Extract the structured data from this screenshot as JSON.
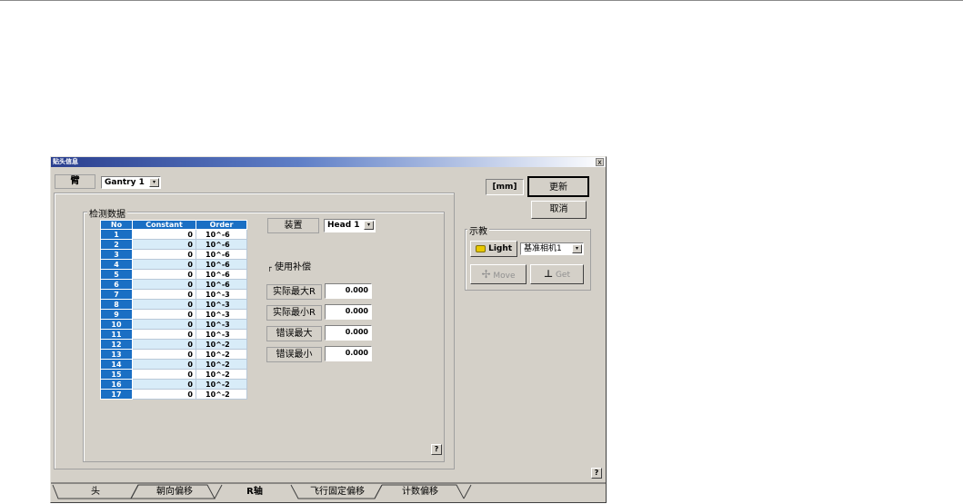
{
  "window": {
    "title": "贴头信息",
    "close": "x"
  },
  "arm": {
    "label": "臂",
    "value": "Gantry 1",
    "dropdown": "▾"
  },
  "unit": "[mm]",
  "buttons": {
    "update": "更新",
    "cancel": "取消"
  },
  "detection": {
    "caption": "检测数据",
    "columns": [
      "No",
      "Constant",
      "Order"
    ],
    "rows": [
      [
        "1",
        "0",
        "10^-6"
      ],
      [
        "2",
        "0",
        "10^-6"
      ],
      [
        "3",
        "0",
        "10^-6"
      ],
      [
        "4",
        "0",
        "10^-6"
      ],
      [
        "5",
        "0",
        "10^-6"
      ],
      [
        "6",
        "0",
        "10^-6"
      ],
      [
        "7",
        "0",
        "10^-3"
      ],
      [
        "8",
        "0",
        "10^-3"
      ],
      [
        "9",
        "0",
        "10^-3"
      ],
      [
        "10",
        "0",
        "10^-3"
      ],
      [
        "11",
        "0",
        "10^-3"
      ],
      [
        "12",
        "0",
        "10^-2"
      ],
      [
        "13",
        "0",
        "10^-2"
      ],
      [
        "14",
        "0",
        "10^-2"
      ],
      [
        "15",
        "0",
        "10^-2"
      ],
      [
        "16",
        "0",
        "10^-2"
      ],
      [
        "17",
        "0",
        "10^-2"
      ]
    ]
  },
  "device": {
    "label": "装置",
    "value": "Head 1"
  },
  "compensation": {
    "checkbox_mark": "┌",
    "label": "使用补偿"
  },
  "measures": [
    {
      "label": "实际最大R",
      "value": "0.000"
    },
    {
      "label": "实际最小R",
      "value": "0.000"
    },
    {
      "label": "错误最大",
      "value": "0.000"
    },
    {
      "label": "错误最小",
      "value": "0.000"
    }
  ],
  "teach": {
    "caption": "示教",
    "light": "Light",
    "camera": "基准相机1",
    "move": "Move",
    "get": "Get"
  },
  "help": "?",
  "tabs": [
    "头",
    "朝向偏移",
    "R轴",
    "飞行固定偏移",
    "计数偏移"
  ],
  "colors": {
    "header_blue": "#1a6fc4",
    "row_alt": "#d8ecf8",
    "dialog_bg": "#d4d0c8",
    "title_blue": "#2a3f8f"
  }
}
